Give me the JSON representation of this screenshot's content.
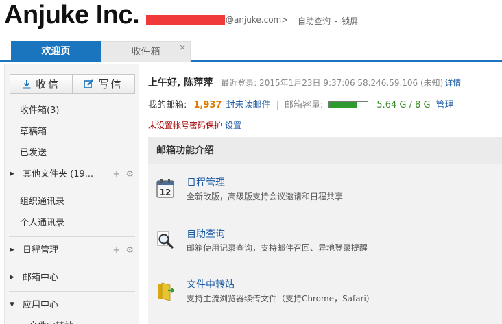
{
  "header": {
    "logo": "Anjuke Inc.",
    "user_email": "en@anjuke.com>",
    "links": [
      "自助查询",
      "锁屏"
    ],
    "link_separator": "-"
  },
  "tabs": [
    {
      "label": "欢迎页"
    },
    {
      "label": "收件箱",
      "close": "×"
    }
  ],
  "sidebar": {
    "receive_label": "收信",
    "compose_label": "写信",
    "items": [
      {
        "label": "收件箱(3)"
      },
      {
        "label": "草稿箱"
      },
      {
        "label": "已发送"
      },
      {
        "label": "其他文件夹 (19..."
      },
      {
        "label": "组织通讯录"
      },
      {
        "label": "个人通讯录"
      },
      {
        "label": "日程管理"
      },
      {
        "label": "邮箱中心"
      },
      {
        "label": "应用中心"
      },
      {
        "label": "文件中转站"
      }
    ],
    "add_icon": "+",
    "gear_icon": "⚙"
  },
  "main": {
    "greeting": "上午好, 陈萍萍",
    "last_login": "最近登录: 2015年1月23日 9:37:06 58.246.59.106 (未知)",
    "details_link": "详情",
    "mailbox_label": "我的邮箱:",
    "unread_count": "1,937",
    "unread_label": "封未读邮件",
    "pipe": "|",
    "capacity_label": "邮箱容量:",
    "capacity_fraction": 0.7,
    "capacity_value": "5.64 G / 8 G",
    "manage_link": "管理",
    "warning": "未设置帐号密码保护",
    "warning_link": "设置",
    "intro_title": "邮箱功能介绍",
    "features": [
      {
        "icon": "calendar-icon",
        "name": "日程管理",
        "desc": "全新改版，高级版支持会议邀请和日程共享"
      },
      {
        "icon": "magnifier-icon",
        "name": "自助查询",
        "desc": "邮箱使用记录查询，支持邮件召回、异地登录提醒"
      },
      {
        "icon": "file-transfer-icon",
        "name": "文件中转站",
        "desc": "支持主流浏览器续传文件（支持Chrome，Safari）"
      }
    ]
  },
  "colors": {
    "accent": "#1b74be",
    "link": "#1b5aa3",
    "count": "#e07b00",
    "warning": "#a40000",
    "capacity": "#2f9a2f",
    "redaction": "#f03a3a"
  }
}
